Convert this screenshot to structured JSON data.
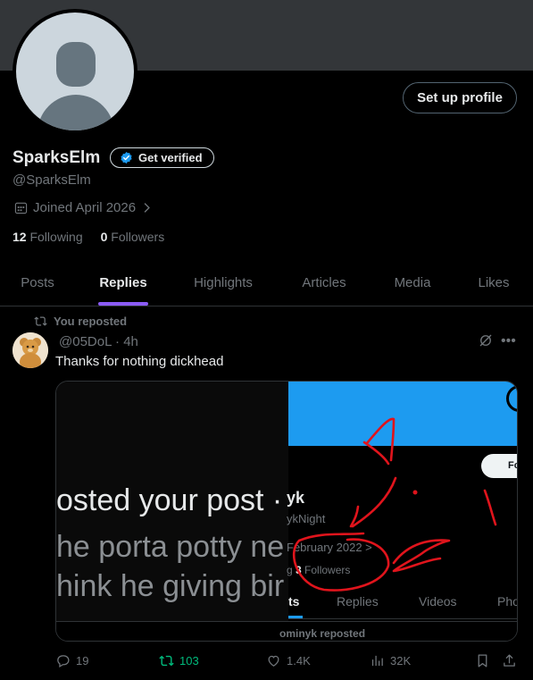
{
  "profile": {
    "name": "SparksElm",
    "handle": "@SparksElm",
    "get_verified": "Get verified",
    "setup_profile": "Set up profile",
    "joined": "Joined April 2026",
    "following_count": "12",
    "following_label": "Following",
    "followers_count": "0",
    "followers_label": "Followers"
  },
  "tabs": [
    {
      "label": "Posts",
      "active": false
    },
    {
      "label": "Replies",
      "active": true
    },
    {
      "label": "Highlights",
      "active": false
    },
    {
      "label": "Articles",
      "active": false
    },
    {
      "label": "Media",
      "active": false
    },
    {
      "label": "Likes",
      "active": false
    }
  ],
  "post": {
    "repost_label": "You reposted",
    "meta": "@05DoL · 4h",
    "text": "Thanks for nothing dickhead",
    "media": {
      "left_lines": [
        "osted your post ·",
        "he porta potty ne",
        "hink he giving bir"
      ],
      "right_name": "yk",
      "right_handle": "ykNight",
      "right_joined": "February 2022 ",
      "right_followers_prefix": "g ",
      "right_followers_count": "3",
      "right_followers_label": "Followers",
      "right_follow": "Fo",
      "right_tabs": [
        "ts",
        "Replies",
        "Videos",
        "Pho"
      ],
      "footer": "ominyk reposted"
    },
    "actions": {
      "replies": "19",
      "reposts": "103",
      "likes": "1.4K",
      "views": "32K"
    }
  },
  "colors": {
    "accent_tab": "#8b5cf6",
    "verified_blue": "#1d9bf0",
    "repost_green": "#00ba7c",
    "scribble_red": "#e0141c"
  }
}
